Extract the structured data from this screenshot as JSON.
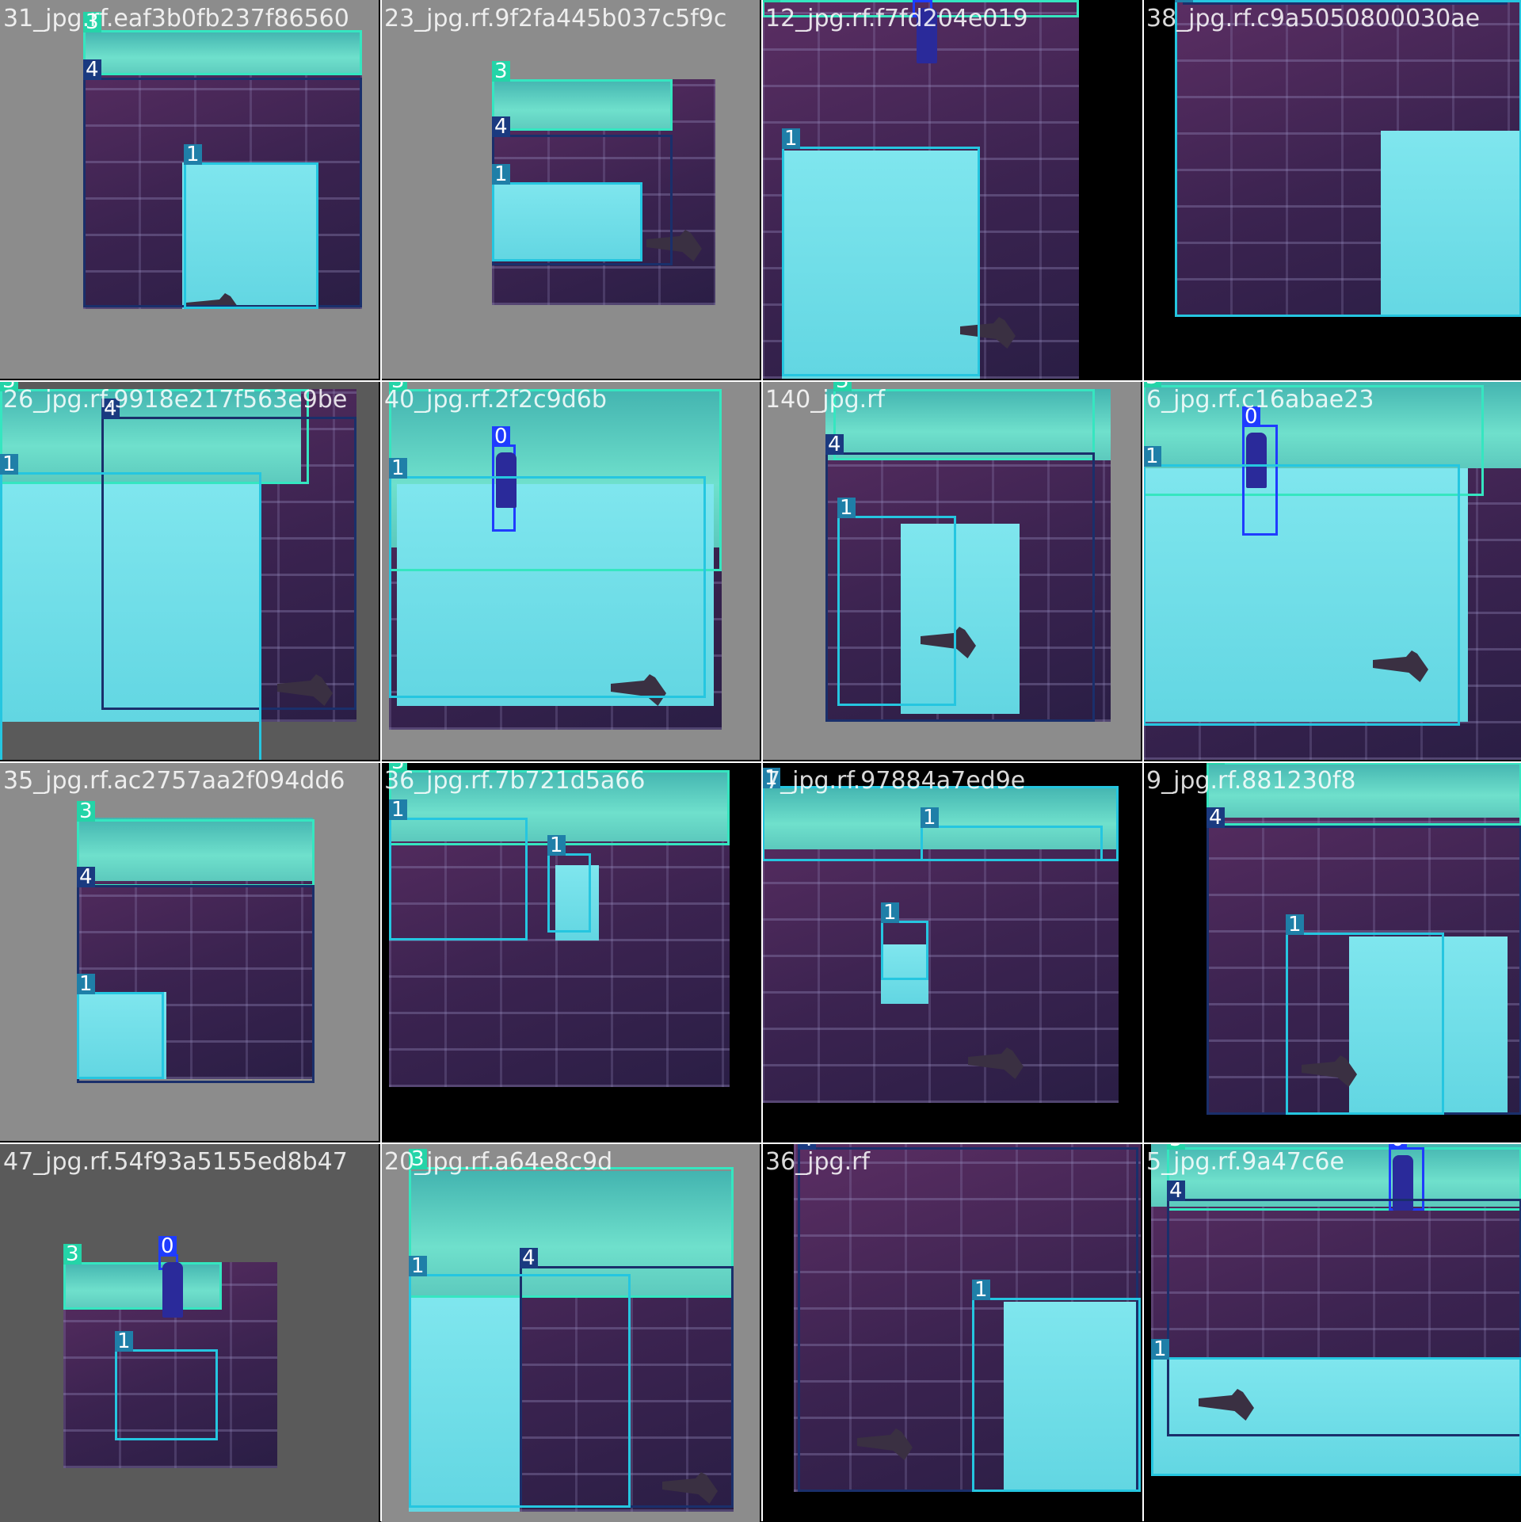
{
  "mosaic": {
    "title": "",
    "class_legend": [
      "0",
      "1",
      "3",
      "4"
    ],
    "tiles": [
      {
        "file": "31_jpg.rf.eaf3b0fb237f86560",
        "classes": [
          "3",
          "4",
          "1"
        ]
      },
      {
        "file": "23_jpg.rf.9f2fa445b037c5f9c",
        "classes": [
          "3",
          "4",
          "1"
        ]
      },
      {
        "file": "12_jpg.rf.f7fd204e019",
        "classes": [
          "3",
          "0",
          "1"
        ]
      },
      {
        "file": "38_jpg.rf.c9a5050800030ae",
        "classes": [
          "4",
          "1"
        ]
      },
      {
        "file": "26_jpg.rf.9918e217f563e9be",
        "classes": [
          "3",
          "4",
          "1"
        ]
      },
      {
        "file": "40_jpg.rf.2f2c9d6b",
        "classes": [
          "3",
          "0",
          "1"
        ]
      },
      {
        "file": "140_jpg.rf",
        "classes": [
          "3",
          "4",
          "1"
        ]
      },
      {
        "file": "6_jpg.rf.c16abae23",
        "classes": [
          "3",
          "0",
          "1"
        ]
      },
      {
        "file": "35_jpg.rf.ac2757aa2f094dd6",
        "classes": [
          "3",
          "4",
          "1"
        ]
      },
      {
        "file": "36_jpg.rf.7b721d5a66",
        "classes": [
          "3",
          "1",
          "1"
        ]
      },
      {
        "file": "7_jpg.rf.97884a7ed9e",
        "classes": [
          "1",
          "1",
          "1"
        ]
      },
      {
        "file": "9_jpg.rf.881230f8",
        "classes": [
          "3",
          "4",
          "1"
        ]
      },
      {
        "file": "47_jpg.rf.54f93a5155ed8b47",
        "classes": [
          "3",
          "0",
          "1"
        ]
      },
      {
        "file": "20_jpg.rf.a64e8c9d",
        "classes": [
          "3",
          "4",
          "1"
        ]
      },
      {
        "file": "36_jpg.rf",
        "classes": [
          "4",
          "1"
        ]
      },
      {
        "file": "5_jpg.rf.9a47c6e",
        "classes": [
          "3",
          "0",
          "4",
          "1"
        ]
      }
    ]
  }
}
